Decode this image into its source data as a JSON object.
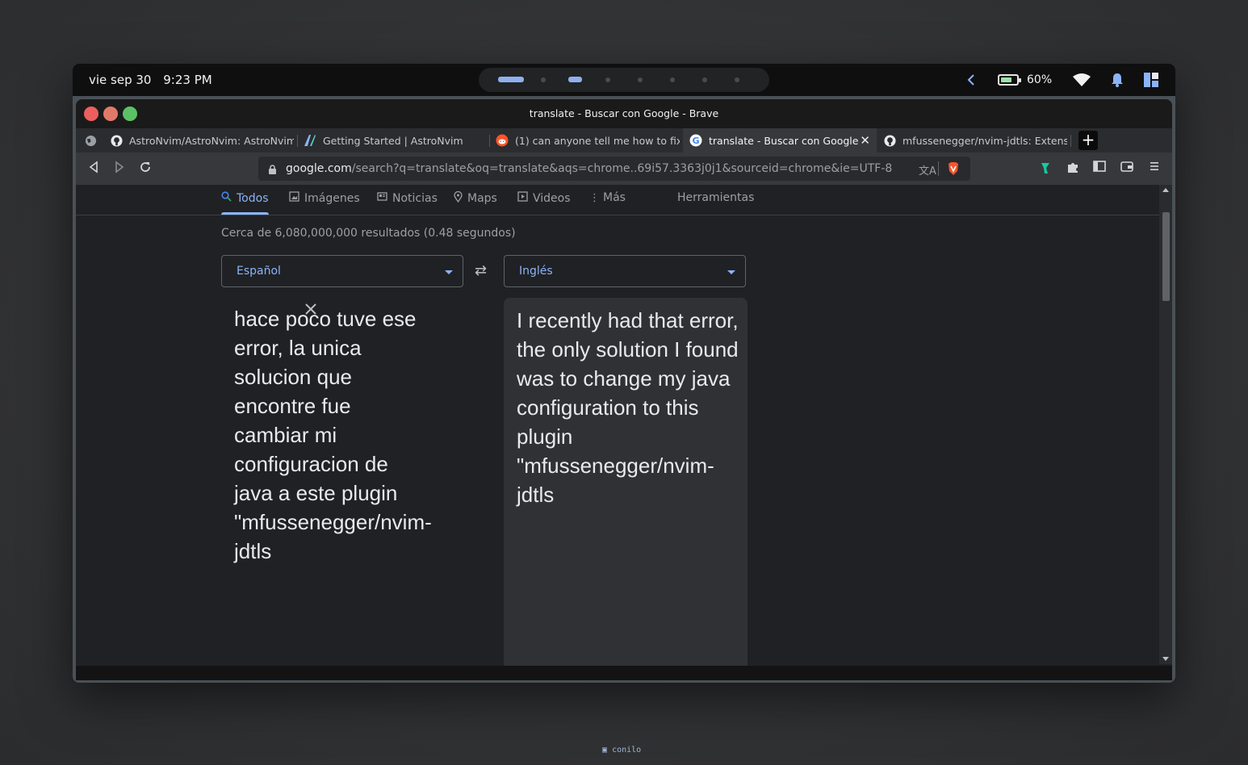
{
  "system_bar": {
    "date": "vie sep 30",
    "time": "9:23 PM",
    "battery_percent": "60%",
    "workspaces": {
      "count": 8,
      "active_indices": [
        0,
        2
      ]
    }
  },
  "browser": {
    "window_title": "translate - Buscar con Google - Brave",
    "tabs": [
      {
        "label": "AstroNvim/AstroNvim: AstroNvim",
        "icon": "github-icon",
        "active": false
      },
      {
        "label": "Getting Started | AstroNvim",
        "icon": "astronvim-icon",
        "active": false
      },
      {
        "label": "(1) can anyone tell me how to fix t",
        "icon": "reddit-icon",
        "active": false
      },
      {
        "label": "translate - Buscar con Google",
        "icon": "google-icon",
        "active": true
      },
      {
        "label": "mfussenegger/nvim-jdtls: Extensi",
        "icon": "github-icon",
        "active": false
      }
    ],
    "new_tab_label": "+",
    "url_host": "google.com",
    "url_path": "/search?q=translate&oq=translate&aqs=chrome..69i57.3363j0j1&sourceid=chrome&ie=UTF-8"
  },
  "search": {
    "nav": [
      {
        "label": "Todos",
        "icon": "search-icon",
        "active": true
      },
      {
        "label": "Imágenes",
        "icon": "image-icon",
        "active": false
      },
      {
        "label": "Noticias",
        "icon": "news-icon",
        "active": false
      },
      {
        "label": "Maps",
        "icon": "map-pin-icon",
        "active": false
      },
      {
        "label": "Videos",
        "icon": "play-icon",
        "active": false
      },
      {
        "label": "Más",
        "icon": "more-vert-icon",
        "active": false
      }
    ],
    "tools_label": "Herramientas",
    "results_stats": "Cerca de 6,080,000,000 resultados (0.48 segundos)"
  },
  "translate": {
    "source_language": "Español",
    "target_language": "Inglés",
    "source_text": "hace poco tuve ese error, la unica solucion que encontre fue cambiar mi configuracion de java a este plugin \"mfussenegger/nvim-jdtls",
    "target_text": "I recently had that error, the only solution I found was to change my java configuration to this plugin \"mfussenegger/nvim-jdtls"
  },
  "footer": {
    "label": "conilo"
  },
  "colors": {
    "accent": "#8ab4f8",
    "page_bg": "#202124",
    "close_button": "#ec5f5e",
    "minimize_button": "#e07a68",
    "maximize_button": "#5cc165",
    "brave_orange": "#fb542b",
    "extension_green": "#17c9a0"
  }
}
